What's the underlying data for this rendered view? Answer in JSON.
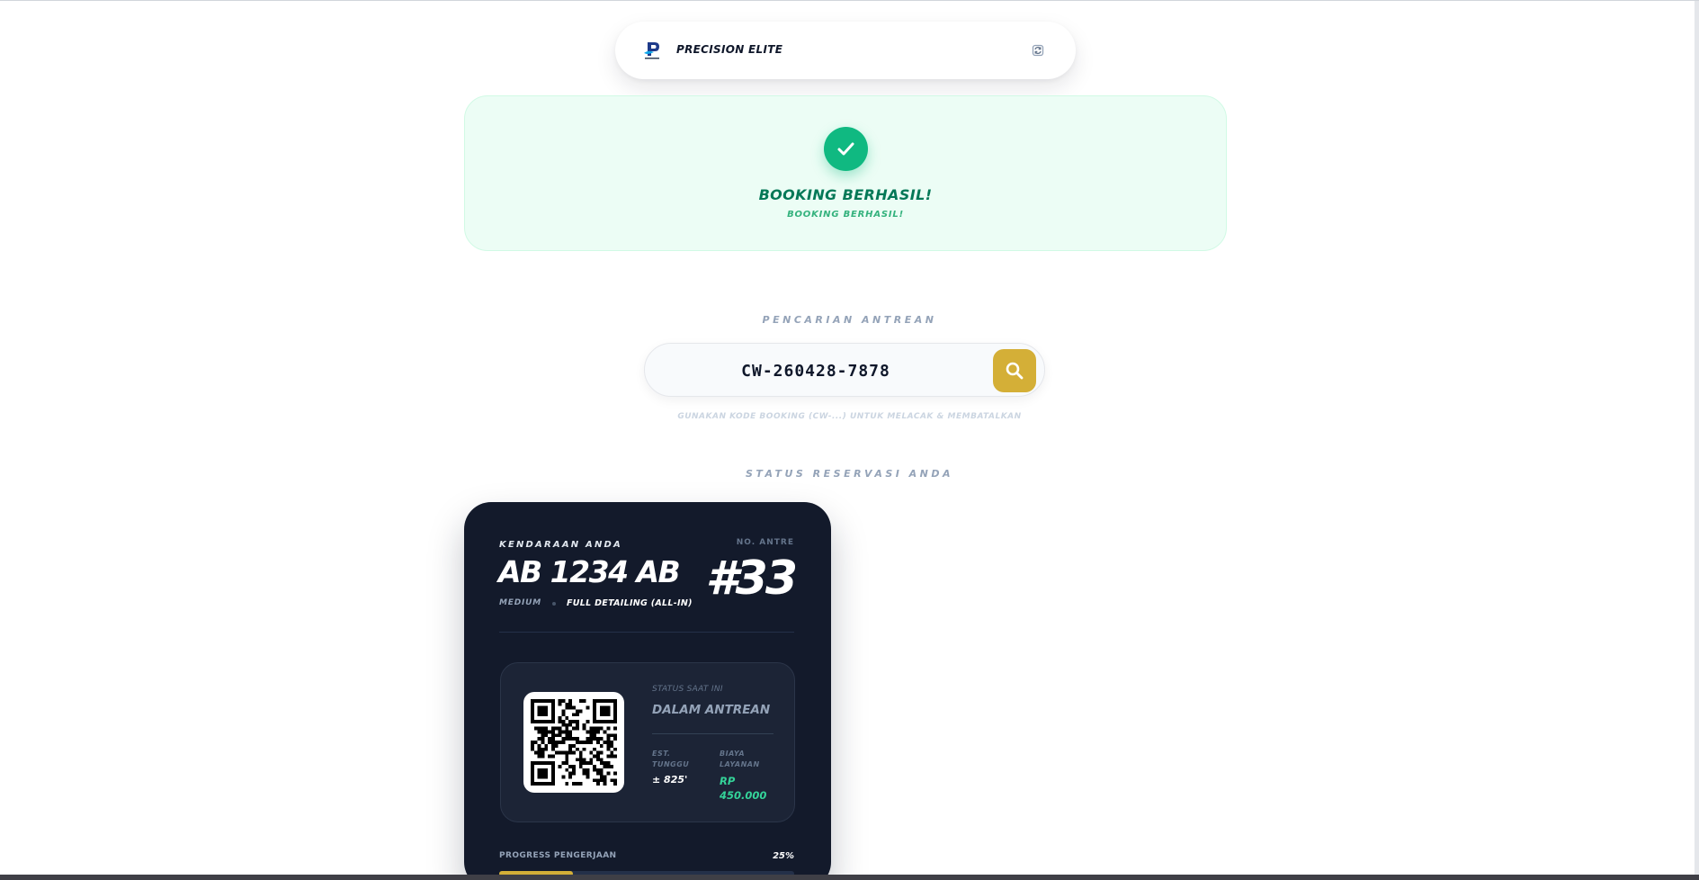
{
  "header": {
    "brand": "PRECISION ELITE",
    "logo_icon": "precision-logo-icon",
    "refresh_icon": "refresh-icon"
  },
  "success": {
    "title": "BOOKING BERHASIL!",
    "subtitle": "BOOKING BERHASIL!",
    "icon": "check-icon",
    "accent": "#10b981"
  },
  "search": {
    "label": "PENCARIAN ANTREAN",
    "value": "CW-260428-7878",
    "hint": "GUNAKAN KODE BOOKING (CW-...) UNTUK MELACAK & MEMBATALKAN",
    "button_icon": "search-icon",
    "button_color": "#d4af37"
  },
  "reservation": {
    "section_label": "STATUS RESERVASI ANDA",
    "vehicle_label": "KENDARAAN ANDA",
    "plate": "AB 1234 AB",
    "queue_label": "NO. ANTRE",
    "queue_number": "#33",
    "size": "MEDIUM",
    "package": "FULL DETAILING (ALL-IN)",
    "status_label": "STATUS SAAT INI",
    "status_value": "DALAM ANTREAN",
    "wait_label": "EST. TUNGGU",
    "wait_value": "± 825'",
    "fee_label": "BIAYA LAYANAN",
    "fee_value": "RP 450.000",
    "progress_label": "PROGRESS PENGERJAAN",
    "progress_text": "25%",
    "progress_value": 0.25,
    "qr_icon": "qr-code-icon"
  }
}
